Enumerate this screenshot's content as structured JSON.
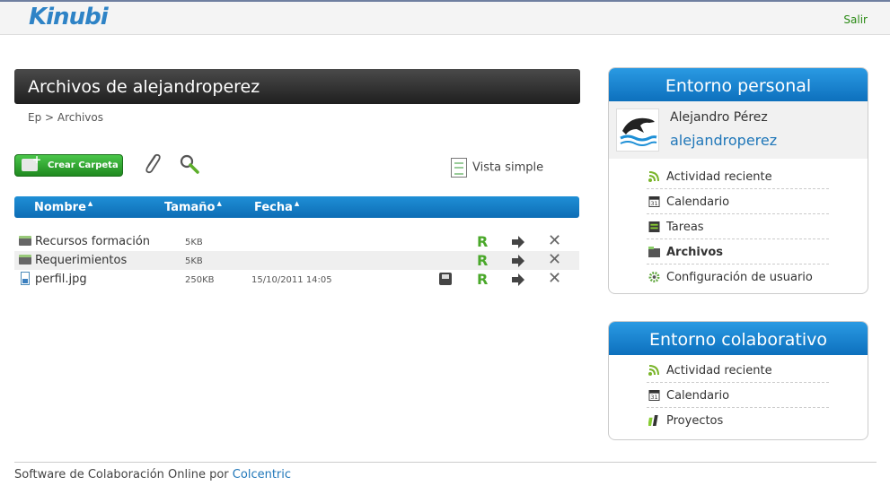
{
  "header": {
    "logo": "Kinubi",
    "logout_label": "Salir"
  },
  "page": {
    "title": "Archivos de alejandroperez",
    "breadcrumb": "Ep > Archivos"
  },
  "toolbar": {
    "create_folder_label": "Crear Carpeta",
    "view_label": "Vista simple"
  },
  "table": {
    "headers": {
      "name": "Nombre",
      "size": "Tamaño",
      "date": "Fecha"
    },
    "rows": [
      {
        "name": "Recursos formación",
        "size": "5KB",
        "date": "",
        "type": "folder"
      },
      {
        "name": "Requerimientos",
        "size": "5KB",
        "date": "",
        "type": "folder"
      },
      {
        "name": "perfil.jpg",
        "size": "250KB",
        "date": "15/10/2011 14:05",
        "type": "file"
      }
    ]
  },
  "personal": {
    "title": "Entorno personal",
    "user_full_name": "Alejandro Pérez",
    "user_login": "alejandroperez",
    "items": [
      {
        "label": "Actividad reciente",
        "icon": "rss-icon"
      },
      {
        "label": "Calendario",
        "icon": "calendar-icon"
      },
      {
        "label": "Tareas",
        "icon": "tasks-icon"
      },
      {
        "label": "Archivos",
        "icon": "folder-icon"
      },
      {
        "label": "Configuración de usuario",
        "icon": "gear-icon"
      }
    ]
  },
  "collab": {
    "title": "Entorno colaborativo",
    "items": [
      {
        "label": "Actividad reciente",
        "icon": "rss-icon"
      },
      {
        "label": "Calendario",
        "icon": "calendar-icon"
      },
      {
        "label": "Proyectos",
        "icon": "projects-icon"
      }
    ]
  },
  "footer": {
    "text": "Software de Colaboración Online por",
    "link": "Colcentric"
  },
  "colors": {
    "accent_blue": "#1583cf",
    "green": "#2a8a15",
    "dark_title": "#2a2a2a"
  }
}
